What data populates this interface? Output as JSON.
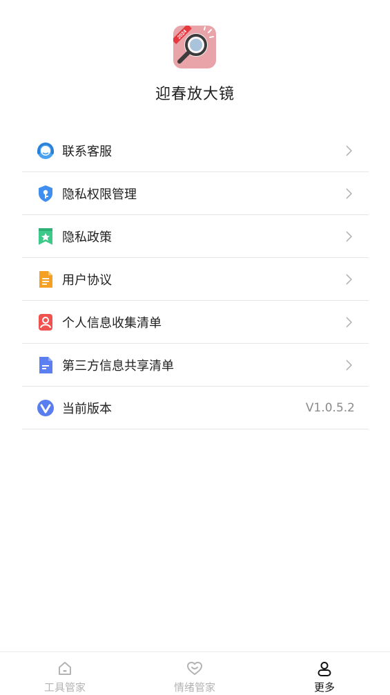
{
  "app": {
    "name": "迎春放大镜",
    "logo_badge": "2024"
  },
  "menu": [
    {
      "label": "联系客服",
      "icon": "customer-service-icon",
      "has_chevron": true
    },
    {
      "label": "隐私权限管理",
      "icon": "privacy-shield-icon",
      "has_chevron": true
    },
    {
      "label": "隐私政策",
      "icon": "bookmark-star-icon",
      "has_chevron": true
    },
    {
      "label": "用户协议",
      "icon": "document-icon",
      "has_chevron": true
    },
    {
      "label": "个人信息收集清单",
      "icon": "person-card-icon",
      "has_chevron": true
    },
    {
      "label": "第三方信息共享清单",
      "icon": "file-share-icon",
      "has_chevron": true
    },
    {
      "label": "当前版本",
      "icon": "version-icon",
      "value": "V1.0.5.2",
      "has_chevron": false
    }
  ],
  "tabbar": {
    "tabs": [
      {
        "label": "工具管家",
        "icon": "home-icon",
        "active": false
      },
      {
        "label": "情绪管家",
        "icon": "heart-icon",
        "active": false
      },
      {
        "label": "更多",
        "icon": "user-icon",
        "active": true
      }
    ]
  },
  "colors": {
    "text": "#1f1f1f",
    "divider": "#e5e5e5",
    "tab_inactive": "#b3b3b3",
    "tab_active": "#111111",
    "logo_bg": "#e8a4a8"
  }
}
